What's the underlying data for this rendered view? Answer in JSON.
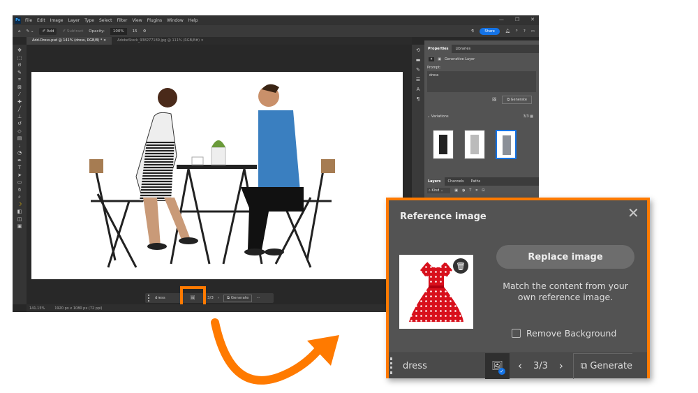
{
  "app": {
    "logo": "Ps",
    "menu": [
      "File",
      "Edit",
      "Image",
      "Layer",
      "Type",
      "Select",
      "Filter",
      "View",
      "Plugins",
      "Window",
      "Help"
    ],
    "window_controls": [
      "—",
      "❐",
      "✕"
    ]
  },
  "options": {
    "add": "Add",
    "subtract": "Subtract",
    "opacity_label": "Opacity:",
    "opacity_value": "100%",
    "brush_size": "15",
    "share": "Share"
  },
  "tabs": [
    {
      "label": "Add-Dress.psd @ 141% (dress, RGB/8) *",
      "active": true
    },
    {
      "label": "AdobeStock_938277189.jpg @ 111% (RGB/8#)",
      "active": false
    }
  ],
  "context_bar": {
    "prompt": "dress",
    "count": "3/3",
    "generate": "Generate",
    "more": "···"
  },
  "status": {
    "zoom": "141.15%",
    "doc_size": "1920 px x 1080 px (72 ppi)"
  },
  "properties": {
    "tabs": [
      "Properties",
      "Libraries"
    ],
    "layer_type": "Generative Layer",
    "prompt_label": "Prompt:",
    "prompt_value": "dress",
    "generate": "Generate",
    "variations_label": "Variations",
    "variations_count": "3/3",
    "selected_variation": 3
  },
  "layers": {
    "tabs": [
      "Layers",
      "Channels",
      "Paths"
    ],
    "filter": "Kind"
  },
  "callout": {
    "title": "Reference image",
    "replace_button": "Replace image",
    "description": "Match the content from your own reference image.",
    "remove_background": "Remove Background",
    "remove_background_checked": false,
    "prompt": "dress",
    "count": "3/3",
    "generate": "Generate"
  },
  "colors": {
    "highlight": "#ff7a00",
    "accent": "#1473e6",
    "dress": "#d8101c"
  }
}
